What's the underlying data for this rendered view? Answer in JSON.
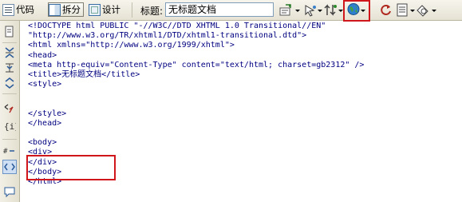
{
  "toolbar": {
    "code_label": "代码",
    "split_label": "拆分",
    "design_label": "设计",
    "title_label": "标题:",
    "title_value": "无标题文档",
    "tools": [
      "file-management-icon",
      "preview-icon",
      "debug-icon",
      "globe-preview-icon",
      "refresh-icon",
      "view-options-icon",
      "visual-aids-icon"
    ]
  },
  "gutter": {
    "tools": [
      "open-documents-icon",
      "collapse-full-tag-icon",
      "collapse-selection-icon",
      "expand-all-icon",
      "select-parent-tag-icon",
      "balance-braces-icon",
      "line-numbers-icon",
      "highlight-invalid-code-icon",
      "apply-comment-icon"
    ]
  },
  "code": {
    "lines": [
      "<!DOCTYPE html PUBLIC \"-//W3C//DTD XHTML 1.0 Transitional//EN\"",
      "\"http://www.w3.org/TR/xhtml1/DTD/xhtml1-transitional.dtd\">",
      "<html xmlns=\"http://www.w3.org/1999/xhtml\">",
      "<head>",
      "<meta http-equiv=\"Content-Type\" content=\"text/html; charset=gb2312\" />",
      "<title>无标题文档</title>",
      "<style>",
      "",
      "",
      "</style>",
      "</head>",
      "",
      "<body>",
      "<div>",
      "</div>",
      "</body>",
      "</html>"
    ]
  },
  "colors": {
    "highlight_box": "#d0161a",
    "code_text": "#000080",
    "toolbar_bg": "#ece9d8"
  }
}
